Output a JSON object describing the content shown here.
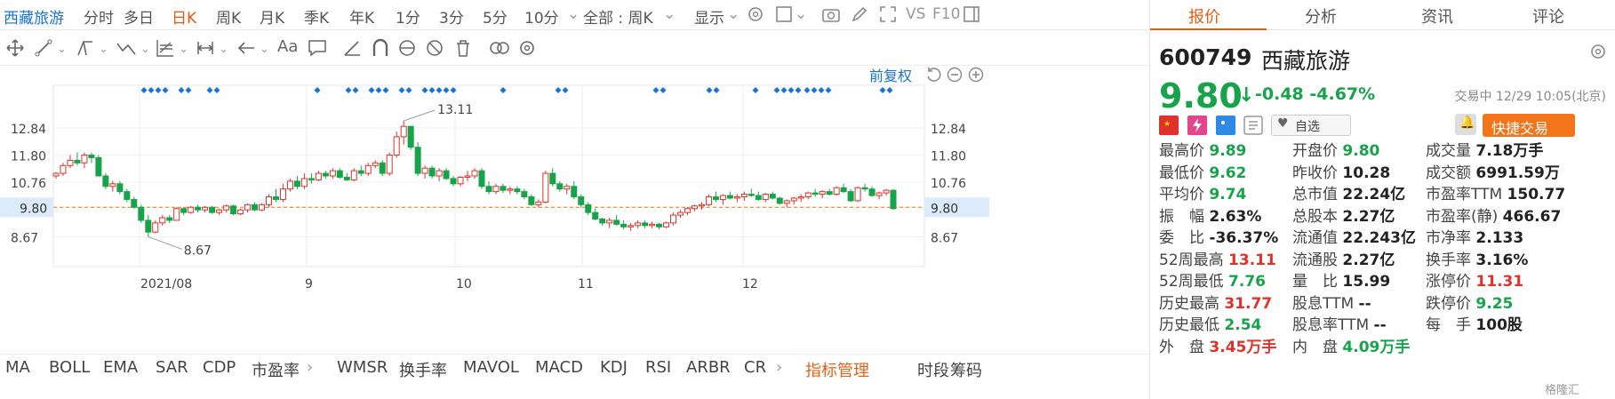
{
  "toolbar": {
    "stock_name": "西藏旅游",
    "periods": [
      "分时",
      "多日",
      "日K",
      "周K",
      "月K",
      "季K",
      "年K",
      "1分",
      "3分",
      "5分",
      "10分"
    ],
    "active_period": "日K",
    "range_select": "全部 : 周K",
    "display_label": "显示",
    "vs_label": "VS",
    "f10_label": "F10"
  },
  "drawing_tools": {
    "text_tool_label": "Aa"
  },
  "chart": {
    "adjust_label": "前复权",
    "y_ticks": [
      "12.84",
      "11.80",
      "10.76",
      "9.80",
      "8.67"
    ],
    "x_labels": [
      "2021/08",
      "9",
      "10",
      "11",
      "12"
    ],
    "high_annotation": "13.11",
    "low_annotation": "8.67",
    "current_price_tag": "9.80",
    "up_color": "#e0312a",
    "down_color": "#17a34a",
    "marker_color": "#1a73d4"
  },
  "chart_data": {
    "type": "candlestick",
    "ylim": [
      7.8,
      14.2
    ],
    "x_axis_labels": [
      "2021/08",
      "9",
      "10",
      "11",
      "12"
    ],
    "ohlc": [
      [
        11.0,
        11.15,
        10.9,
        11.1
      ],
      [
        11.1,
        11.5,
        11.0,
        11.4
      ],
      [
        11.4,
        11.8,
        11.3,
        11.6
      ],
      [
        11.6,
        11.9,
        11.4,
        11.5
      ],
      [
        11.5,
        11.9,
        11.3,
        11.8
      ],
      [
        11.8,
        11.9,
        11.5,
        11.7
      ],
      [
        11.7,
        11.8,
        11.0,
        11.0
      ],
      [
        11.0,
        11.1,
        10.5,
        10.6
      ],
      [
        10.6,
        10.8,
        10.4,
        10.7
      ],
      [
        10.7,
        10.8,
        10.3,
        10.4
      ],
      [
        10.4,
        10.5,
        10.0,
        10.1
      ],
      [
        10.1,
        10.2,
        9.75,
        9.8
      ],
      [
        9.8,
        9.9,
        9.2,
        9.3
      ],
      [
        9.3,
        9.5,
        8.67,
        8.85
      ],
      [
        8.85,
        9.3,
        8.8,
        9.2
      ],
      [
        9.2,
        9.5,
        9.1,
        9.4
      ],
      [
        9.4,
        9.5,
        9.2,
        9.3
      ],
      [
        9.3,
        9.8,
        9.3,
        9.75
      ],
      [
        9.75,
        9.8,
        9.5,
        9.6
      ],
      [
        9.6,
        9.85,
        9.55,
        9.8
      ],
      [
        9.8,
        9.9,
        9.6,
        9.7
      ],
      [
        9.7,
        9.85,
        9.6,
        9.8
      ],
      [
        9.8,
        9.85,
        9.55,
        9.6
      ],
      [
        9.6,
        9.75,
        9.5,
        9.7
      ],
      [
        9.7,
        9.9,
        9.6,
        9.85
      ],
      [
        9.85,
        9.9,
        9.5,
        9.55
      ],
      [
        9.55,
        9.75,
        9.5,
        9.7
      ],
      [
        9.7,
        9.95,
        9.6,
        9.9
      ],
      [
        9.9,
        10.0,
        9.65,
        9.7
      ],
      [
        9.7,
        9.95,
        9.65,
        9.9
      ],
      [
        9.9,
        10.3,
        9.8,
        10.2
      ],
      [
        10.2,
        10.5,
        10.0,
        10.1
      ],
      [
        10.1,
        10.7,
        10.0,
        10.5
      ],
      [
        10.5,
        10.9,
        10.4,
        10.8
      ],
      [
        10.8,
        11.0,
        10.5,
        10.6
      ],
      [
        10.6,
        11.1,
        10.5,
        10.9
      ],
      [
        10.9,
        11.1,
        10.7,
        10.85
      ],
      [
        10.85,
        11.2,
        10.8,
        11.1
      ],
      [
        11.1,
        11.2,
        10.9,
        11.0
      ],
      [
        11.0,
        11.3,
        10.9,
        11.2
      ],
      [
        11.2,
        11.3,
        10.9,
        10.95
      ],
      [
        10.95,
        11.1,
        10.8,
        10.85
      ],
      [
        10.85,
        11.3,
        10.8,
        11.2
      ],
      [
        11.2,
        11.4,
        11.0,
        11.1
      ],
      [
        11.1,
        11.5,
        11.0,
        11.4
      ],
      [
        11.4,
        11.6,
        11.3,
        11.5
      ],
      [
        11.5,
        11.6,
        11.0,
        11.1
      ],
      [
        11.1,
        11.9,
        11.0,
        11.8
      ],
      [
        11.8,
        12.7,
        11.7,
        12.5
      ],
      [
        12.5,
        13.11,
        12.2,
        12.9
      ],
      [
        12.9,
        12.9,
        12.0,
        12.1
      ],
      [
        12.1,
        12.3,
        11.0,
        11.1
      ],
      [
        11.1,
        11.4,
        10.9,
        11.3
      ],
      [
        11.3,
        11.4,
        10.9,
        11.0
      ],
      [
        11.0,
        11.3,
        10.8,
        11.2
      ],
      [
        11.2,
        11.3,
        10.85,
        10.9
      ],
      [
        10.9,
        11.0,
        10.6,
        10.7
      ],
      [
        10.7,
        11.0,
        10.6,
        10.95
      ],
      [
        10.95,
        11.2,
        10.8,
        11.0
      ],
      [
        11.0,
        11.3,
        10.9,
        11.2
      ],
      [
        11.2,
        11.3,
        10.5,
        10.6
      ],
      [
        10.6,
        10.8,
        10.3,
        10.4
      ],
      [
        10.4,
        10.7,
        10.3,
        10.6
      ],
      [
        10.6,
        10.7,
        10.35,
        10.45
      ],
      [
        10.45,
        10.6,
        10.3,
        10.5
      ],
      [
        10.5,
        10.6,
        10.3,
        10.4
      ],
      [
        10.4,
        10.5,
        10.1,
        10.2
      ],
      [
        10.2,
        10.3,
        9.85,
        9.9
      ],
      [
        9.9,
        10.1,
        9.8,
        10.0
      ],
      [
        10.0,
        11.2,
        9.95,
        11.1
      ],
      [
        11.1,
        11.3,
        10.6,
        10.7
      ],
      [
        10.7,
        10.8,
        10.4,
        10.5
      ],
      [
        10.5,
        10.7,
        10.3,
        10.6
      ],
      [
        10.6,
        10.8,
        10.1,
        10.2
      ],
      [
        10.2,
        10.3,
        9.8,
        9.9
      ],
      [
        9.9,
        10.0,
        9.5,
        9.6
      ],
      [
        9.6,
        9.75,
        9.3,
        9.35
      ],
      [
        9.35,
        9.4,
        9.1,
        9.2
      ],
      [
        9.2,
        9.4,
        9.0,
        9.3
      ],
      [
        9.3,
        9.5,
        9.1,
        9.15
      ],
      [
        9.15,
        9.3,
        8.95,
        9.05
      ],
      [
        9.05,
        9.2,
        8.9,
        9.1
      ],
      [
        9.1,
        9.3,
        9.0,
        9.2
      ],
      [
        9.2,
        9.3,
        9.0,
        9.1
      ],
      [
        9.1,
        9.25,
        9.0,
        9.15
      ],
      [
        9.15,
        9.2,
        8.95,
        9.05
      ],
      [
        9.05,
        9.25,
        9.0,
        9.2
      ],
      [
        9.2,
        9.6,
        9.1,
        9.5
      ],
      [
        9.5,
        9.7,
        9.4,
        9.6
      ],
      [
        9.6,
        9.8,
        9.5,
        9.75
      ],
      [
        9.75,
        9.9,
        9.65,
        9.85
      ],
      [
        9.85,
        10.0,
        9.7,
        9.9
      ],
      [
        9.9,
        10.3,
        9.85,
        10.2
      ],
      [
        10.2,
        10.4,
        10.0,
        10.1
      ],
      [
        10.1,
        10.3,
        9.9,
        10.25
      ],
      [
        10.25,
        10.4,
        10.1,
        10.15
      ],
      [
        10.15,
        10.3,
        10.0,
        10.2
      ],
      [
        10.2,
        10.4,
        10.05,
        10.3
      ],
      [
        10.3,
        10.5,
        10.2,
        10.25
      ],
      [
        10.25,
        10.4,
        10.05,
        10.1
      ],
      [
        10.1,
        10.35,
        10.0,
        10.3
      ],
      [
        10.3,
        10.4,
        10.1,
        10.15
      ],
      [
        10.15,
        10.2,
        9.9,
        9.95
      ],
      [
        9.95,
        10.1,
        9.8,
        10.05
      ],
      [
        10.05,
        10.2,
        9.9,
        10.15
      ],
      [
        10.15,
        10.3,
        10.0,
        10.2
      ],
      [
        10.2,
        10.4,
        10.1,
        10.35
      ],
      [
        10.35,
        10.5,
        10.2,
        10.3
      ],
      [
        10.3,
        10.45,
        10.15,
        10.4
      ],
      [
        10.4,
        10.5,
        10.25,
        10.3
      ],
      [
        10.3,
        10.6,
        10.25,
        10.55
      ],
      [
        10.55,
        10.7,
        10.35,
        10.4
      ],
      [
        10.4,
        10.5,
        10.0,
        10.05
      ],
      [
        10.05,
        10.6,
        10.0,
        10.55
      ],
      [
        10.55,
        10.7,
        10.4,
        10.5
      ],
      [
        10.5,
        10.6,
        10.2,
        10.25
      ],
      [
        10.25,
        10.4,
        10.1,
        10.35
      ],
      [
        10.35,
        10.5,
        10.25,
        10.45
      ],
      [
        10.45,
        10.5,
        9.7,
        9.75
      ]
    ],
    "markers_row": "signal markers above candles"
  },
  "indicators": {
    "left": [
      "MA",
      "BOLL",
      "EMA",
      "SAR",
      "CDP",
      "市盈率"
    ],
    "right": [
      "WMSR",
      "换手率",
      "MAVOL",
      "MACD",
      "KDJ",
      "RSI",
      "ARBR",
      "CR"
    ],
    "manage_label": "指标管理",
    "period_tabs": [
      "时段",
      "筹码"
    ]
  },
  "panel": {
    "tabs": [
      "报价",
      "分析",
      "资讯",
      "评论"
    ],
    "active_tab": "报价",
    "code": "600749",
    "name": "西藏旅游",
    "price": "9.80",
    "change": "-0.48",
    "change_pct": "-4.67%",
    "status": "交易中 12/29 10:05(北京)",
    "watch_label": "自选",
    "trade_label": "快捷交易",
    "stats": [
      [
        {
          "k": "最高价",
          "v": "9.89",
          "c": "green"
        },
        {
          "k": "开盘价",
          "v": "9.80",
          "c": "green"
        },
        {
          "k": "成交量",
          "v": "7.18万手",
          "c": "dark"
        }
      ],
      [
        {
          "k": "最低价",
          "v": "9.62",
          "c": "green"
        },
        {
          "k": "昨收价",
          "v": "10.28",
          "c": "dark"
        },
        {
          "k": "成交额",
          "v": "6991.59万",
          "c": "dark"
        }
      ],
      [
        {
          "k": "平均价",
          "v": "9.74",
          "c": "green"
        },
        {
          "k": "总市值",
          "v": "22.24亿",
          "c": "dark"
        },
        {
          "k": "市盈率TTM",
          "v": "150.77",
          "c": "dark"
        }
      ],
      [
        {
          "k": "振　幅",
          "v": "2.63%",
          "c": "dark"
        },
        {
          "k": "总股本",
          "v": "2.27亿",
          "c": "dark"
        },
        {
          "k": "市盈率(静)",
          "v": "466.67",
          "c": "dark"
        }
      ],
      [
        {
          "k": "委　比",
          "v": "-36.37%",
          "c": "dark"
        },
        {
          "k": "流通值",
          "v": "22.243亿",
          "c": "dark"
        },
        {
          "k": "市净率",
          "v": "2.133",
          "c": "dark"
        }
      ],
      [
        {
          "k": "52周最高",
          "v": "13.11",
          "c": "red"
        },
        {
          "k": "流通股",
          "v": "2.27亿",
          "c": "dark"
        },
        {
          "k": "换手率",
          "v": "3.16%",
          "c": "dark"
        }
      ],
      [
        {
          "k": "52周最低",
          "v": "7.76",
          "c": "green"
        },
        {
          "k": "量　比",
          "v": "15.99",
          "c": "dark"
        },
        {
          "k": "涨停价",
          "v": "11.31",
          "c": "red"
        }
      ],
      [
        {
          "k": "历史最高",
          "v": "31.77",
          "c": "red"
        },
        {
          "k": "股息TTM",
          "v": "--",
          "c": "dark"
        },
        {
          "k": "跌停价",
          "v": "9.25",
          "c": "green"
        }
      ],
      [
        {
          "k": "历史最低",
          "v": "2.54",
          "c": "green"
        },
        {
          "k": "股息率TTM",
          "v": "--",
          "c": "dark"
        },
        {
          "k": "每　手",
          "v": "100股",
          "c": "dark"
        }
      ],
      [
        {
          "k": "外　盘",
          "v": "3.45万手",
          "c": "red"
        },
        {
          "k": "内　盘",
          "v": "4.09万手",
          "c": "green"
        },
        {
          "k": "",
          "v": "",
          "c": "dark"
        }
      ]
    ],
    "watermark": "格隆汇"
  }
}
